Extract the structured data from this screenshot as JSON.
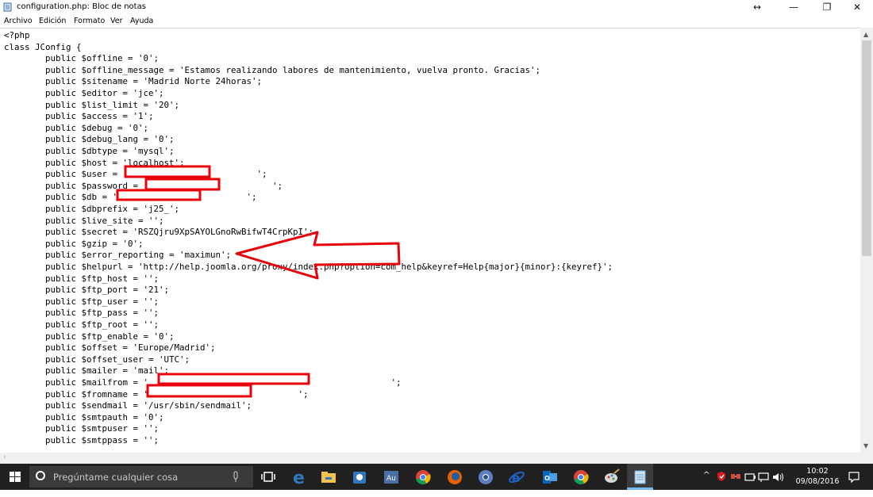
{
  "window": {
    "title": "configuration.php: Bloc de notas",
    "resize_glyph": "↔",
    "minimize_glyph": "—",
    "maximize_glyph": "❐",
    "close_glyph": "✕"
  },
  "menu": [
    "Archivo",
    "Edición",
    "Formato",
    "Ver",
    "Ayuda"
  ],
  "lines": [
    "<?php",
    "class JConfig {",
    "        public $offline = '0';",
    "        public $offline_message = 'Estamos realizando labores de mantenimiento, vuelva pronto. Gracias';",
    "        public $sitename = 'Madrid Norte 24horas';",
    "        public $editor = 'jce';",
    "        public $list_limit = '20';",
    "        public $access = '1';",
    "        public $debug = '0';",
    "        public $debug_lang = '0';",
    "        public $dbtype = 'mysql';",
    "        public $host = 'localhost';",
    "        public $user = '                         ';",
    "        public $password = '                        ';",
    "        public $db = '                         ';",
    "        public $dbprefix = 'j25_';",
    "        public $live_site = '';",
    "        public $secret = 'RSZQjru9XpSAYOLGnoRwBifwT4CrpKpI';",
    "        public $gzip = '0';",
    "        public $error_reporting = 'maximun';",
    "        public $helpurl = 'http://help.joomla.org/proxy/index.php?option=com_help&keyref=Help{major}{minor}:{keyref}';",
    "        public $ftp_host = '';",
    "        public $ftp_port = '21';",
    "        public $ftp_user = '';",
    "        public $ftp_pass = '';",
    "        public $ftp_root = '';",
    "        public $ftp_enable = '0';",
    "        public $offset = 'Europe/Madrid';",
    "        public $offset_user = 'UTC';",
    "        public $mailer = 'mail';",
    "        public $mailfrom = '                                               ';",
    "        public $fromname = '                             ';",
    "        public $sendmail = '/usr/sbin/sendmail';",
    "        public $smtpauth = '0';",
    "        public $smtpuser = '';",
    "        public $smtppass = '';"
  ],
  "taskbar": {
    "search_placeholder": "Pregúntame cualquier cosa",
    "clock_time": "10:02",
    "clock_date": "09/08/2016"
  },
  "colors": {
    "taskbar_bg": "#202020",
    "annotation_red": "#e8000b",
    "windows_blue": "#00a4ef"
  },
  "icons": [
    "notepad-icon",
    "windows-start-icon",
    "cortana-circle-icon",
    "microphone-icon",
    "task-view-icon",
    "edge-icon",
    "file-explorer-icon",
    "store-icon",
    "au-app-icon",
    "chrome-icon",
    "firefox-icon",
    "chrome-alt-icon",
    "ie-icon",
    "outlook-icon",
    "chrome-2-icon",
    "paint-icon",
    "notepad-taskbar-icon",
    "chevron-up-icon",
    "shield-icon",
    "network-icon",
    "battery-icon",
    "chat-icon",
    "volume-icon",
    "notification-icon"
  ]
}
